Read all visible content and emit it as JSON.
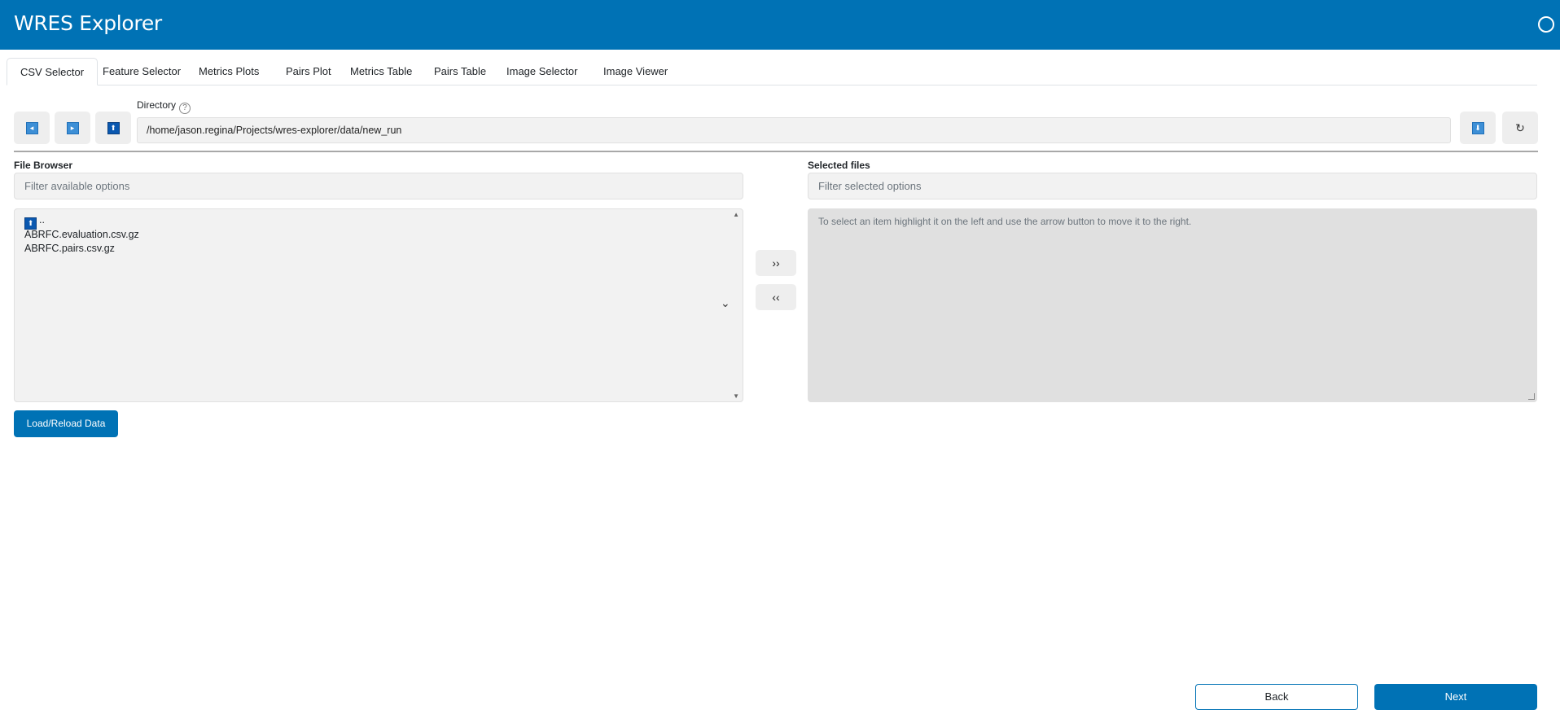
{
  "header": {
    "title": "WRES Explorer"
  },
  "tabs": [
    {
      "label": "CSV Selector",
      "active": true
    },
    {
      "label": "Feature Selector"
    },
    {
      "label": "Metrics Plots"
    },
    {
      "label": "Pairs Plot"
    },
    {
      "label": "Metrics Table"
    },
    {
      "label": "Pairs Table"
    },
    {
      "label": "Image Selector"
    },
    {
      "label": "Image Viewer"
    }
  ],
  "directory": {
    "label": "Directory",
    "help": "?",
    "value": "/home/jason.regina/Projects/wres-explorer/data/new_run",
    "back_icon": "◂",
    "forward_icon": "▸",
    "up_icon": "⬆",
    "down_icon": "⬇",
    "refresh_icon": "↻"
  },
  "file_browser": {
    "label": "File Browser",
    "filter_placeholder": "Filter available options",
    "parent_icon": "⬆",
    "items": [
      "..",
      "ABRFC.evaluation.csv.gz",
      "ABRFC.pairs.csv.gz"
    ],
    "scroll_up": "▲",
    "scroll_down": "▼",
    "chevron": "⌄"
  },
  "selected_files": {
    "label": "Selected files",
    "filter_placeholder": "Filter selected options",
    "empty_message": "To select an item highlight it on the left and use the arrow button to move it to the right."
  },
  "buttons": {
    "move_right": "››",
    "move_left": "‹‹",
    "load": "Load/Reload Data",
    "back": "Back",
    "next": "Next"
  },
  "colors": {
    "primary": "#0072b5"
  }
}
